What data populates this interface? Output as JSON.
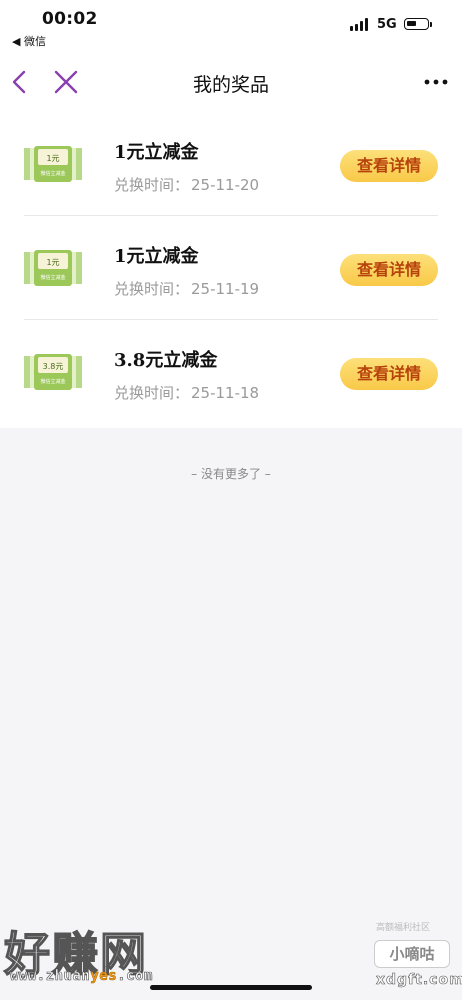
{
  "status_bar": {
    "time": "00:02",
    "back_app": "◀ 微信",
    "network": "5G",
    "battery_level": 0.45
  },
  "nav": {
    "title": "我的奖品",
    "back_icon": "chevron-left-icon",
    "close_icon": "close-icon",
    "more_icon": "more-dots-icon",
    "accent": "#8a3fb0"
  },
  "prizes": [
    {
      "name": "1元立减金",
      "time_label": "兑换时间：",
      "time": "25-11-20",
      "button": "查看详情",
      "voucher_value": "1元",
      "voucher_caption": "微信立减金"
    },
    {
      "name": "1元立减金",
      "time_label": "兑换时间：",
      "time": "25-11-19",
      "button": "查看详情",
      "voucher_value": "1元",
      "voucher_caption": "微信立减金"
    },
    {
      "name": "3.8元立减金",
      "time_label": "兑换时间：",
      "time": "25-11-18",
      "button": "查看详情",
      "voucher_value": "3.8元",
      "voucher_caption": "微信立减金"
    }
  ],
  "end_note": "– 没有更多了 –",
  "watermark": {
    "left_big": "好赚网",
    "left_url_a": "www.zhuan",
    "left_url_yes": "yes",
    "left_url_b": ".com",
    "right_small": "高额福利社区",
    "right_badge": "小嘀咕",
    "right_domain": "xdgft.com"
  },
  "colors": {
    "button_top": "#fde07a",
    "button_bottom": "#f8c948",
    "button_text": "#b8420c",
    "voucher_green": "#8cc04a"
  }
}
